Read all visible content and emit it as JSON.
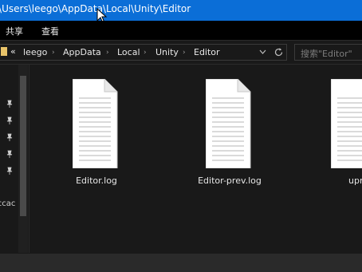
{
  "window": {
    "title": ":\\Users\\leego\\AppData\\Local\\Unity\\Editor"
  },
  "menu": {
    "share": "共享",
    "view": "查看"
  },
  "address": {
    "back_marker": "«",
    "crumbs": [
      "leego",
      "AppData",
      "Local",
      "Unity",
      "Editor"
    ]
  },
  "search": {
    "placeholder": "搜索\"Editor\""
  },
  "sidebar": {
    "clipped_label": "lccac"
  },
  "files": [
    {
      "name": "Editor.log",
      "icon": "text-file-icon"
    },
    {
      "name": "Editor-prev.log",
      "icon": "text-file-icon"
    },
    {
      "name": "upm",
      "icon": "text-file-icon"
    }
  ],
  "colors": {
    "titlebar": "#0b6ed7",
    "background": "#191919",
    "menubar": "#000000",
    "file_icon": "#ffffff"
  }
}
